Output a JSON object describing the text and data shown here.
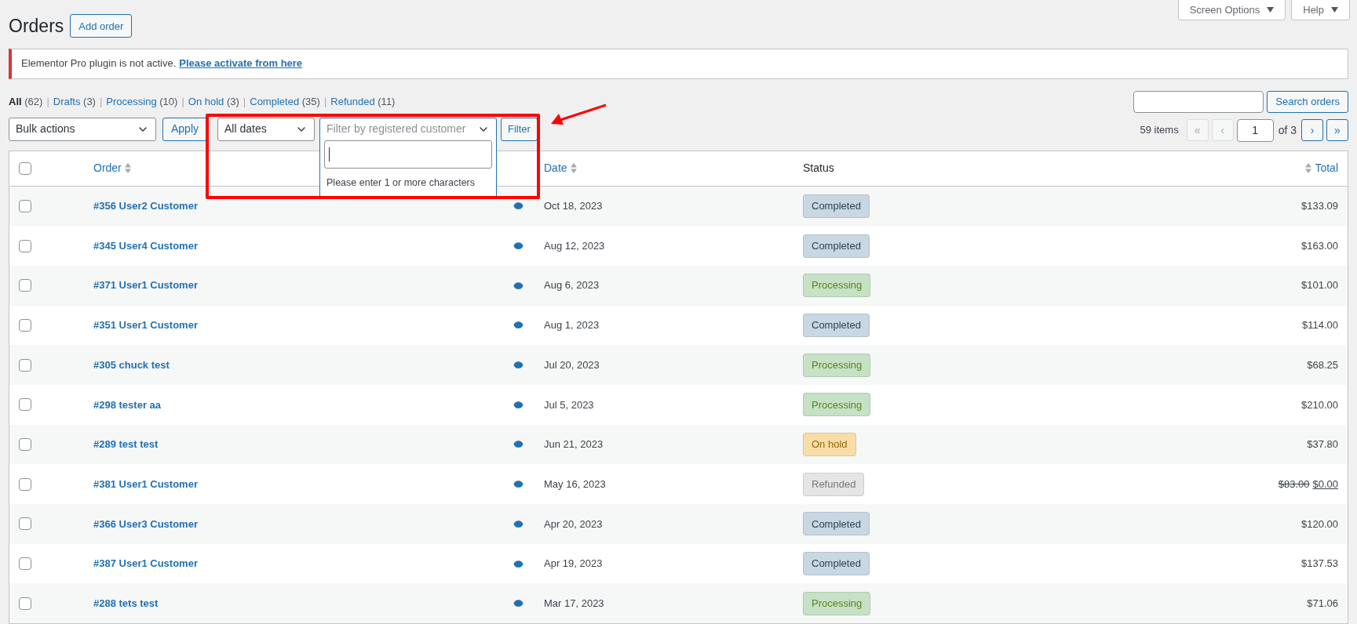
{
  "header": {
    "title": "Orders",
    "add_button": "Add order",
    "screen_options": "Screen Options",
    "help": "Help"
  },
  "notice": {
    "text": "Elementor Pro plugin is not active.",
    "link": "Please activate from here"
  },
  "status_links": {
    "separator": "|",
    "items": [
      {
        "label": "All",
        "count": "(62)",
        "selected": true
      },
      {
        "label": "Drafts",
        "count": "(3)",
        "selected": false
      },
      {
        "label": "Processing",
        "count": "(10)",
        "selected": false
      },
      {
        "label": "On hold",
        "count": "(3)",
        "selected": false
      },
      {
        "label": "Completed",
        "count": "(35)",
        "selected": false
      },
      {
        "label": "Refunded",
        "count": "(11)",
        "selected": false
      }
    ]
  },
  "toolbar": {
    "bulk_actions": "Bulk actions",
    "apply": "Apply",
    "dates": "All dates",
    "customer_filter": {
      "placeholder": "Filter by registered customer",
      "expanded": true,
      "hint": "Please enter 1 or more characters"
    },
    "filter": "Filter"
  },
  "search": {
    "button": "Search orders"
  },
  "pagination": {
    "items": "59 items",
    "buttons_before": [
      {
        "label": "«",
        "disabled": true
      },
      {
        "label": "‹",
        "disabled": true
      }
    ],
    "page": "1",
    "of": "of 3",
    "buttons_after": [
      {
        "label": "›",
        "disabled": false
      },
      {
        "label": "»",
        "disabled": false
      }
    ]
  },
  "table": {
    "select_all": {
      "checked": false
    },
    "columns": [
      {
        "label": "Order",
        "sortable": true
      },
      {
        "label": "Date",
        "sortable": true
      },
      {
        "label": "Status",
        "sortable": false
      },
      {
        "label": "Total",
        "sortable": true
      }
    ],
    "rows": [
      {
        "order": "#356 User2 Customer",
        "date": "Oct 18, 2023",
        "status": "Completed",
        "kind": "completed",
        "total": "$133.09",
        "checked": false
      },
      {
        "order": "#345 User4 Customer",
        "date": "Aug 12, 2023",
        "status": "Completed",
        "kind": "completed",
        "total": "$163.00",
        "checked": false
      },
      {
        "order": "#371 User1 Customer",
        "date": "Aug 6, 2023",
        "status": "Processing",
        "kind": "processing",
        "total": "$101.00",
        "checked": false
      },
      {
        "order": "#351 User1 Customer",
        "date": "Aug 1, 2023",
        "status": "Completed",
        "kind": "completed",
        "total": "$114.00",
        "checked": false
      },
      {
        "order": "#305 chuck test",
        "date": "Jul 20, 2023",
        "status": "Processing",
        "kind": "processing",
        "total": "$68.25",
        "checked": false
      },
      {
        "order": "#298 tester aa",
        "date": "Jul 5, 2023",
        "status": "Processing",
        "kind": "processing",
        "total": "$210.00",
        "checked": false
      },
      {
        "order": "#289 test test",
        "date": "Jun 21, 2023",
        "status": "On hold",
        "kind": "on-hold",
        "total": "$37.80",
        "checked": false
      },
      {
        "order": "#381 User1 Customer",
        "date": "May 16, 2023",
        "status": "Refunded",
        "kind": "refunded",
        "original_total": "$83.00",
        "total": "$0.00",
        "checked": false
      },
      {
        "order": "#366 User3 Customer",
        "date": "Apr 20, 2023",
        "status": "Completed",
        "kind": "completed",
        "total": "$120.00",
        "checked": false
      },
      {
        "order": "#387 User1 Customer",
        "date": "Apr 19, 2023",
        "status": "Completed",
        "kind": "completed",
        "total": "$137.53",
        "checked": false
      },
      {
        "order": "#288 tets test",
        "date": "Mar 17, 2023",
        "status": "Processing",
        "kind": "processing",
        "total": "$71.06",
        "checked": false
      }
    ]
  }
}
